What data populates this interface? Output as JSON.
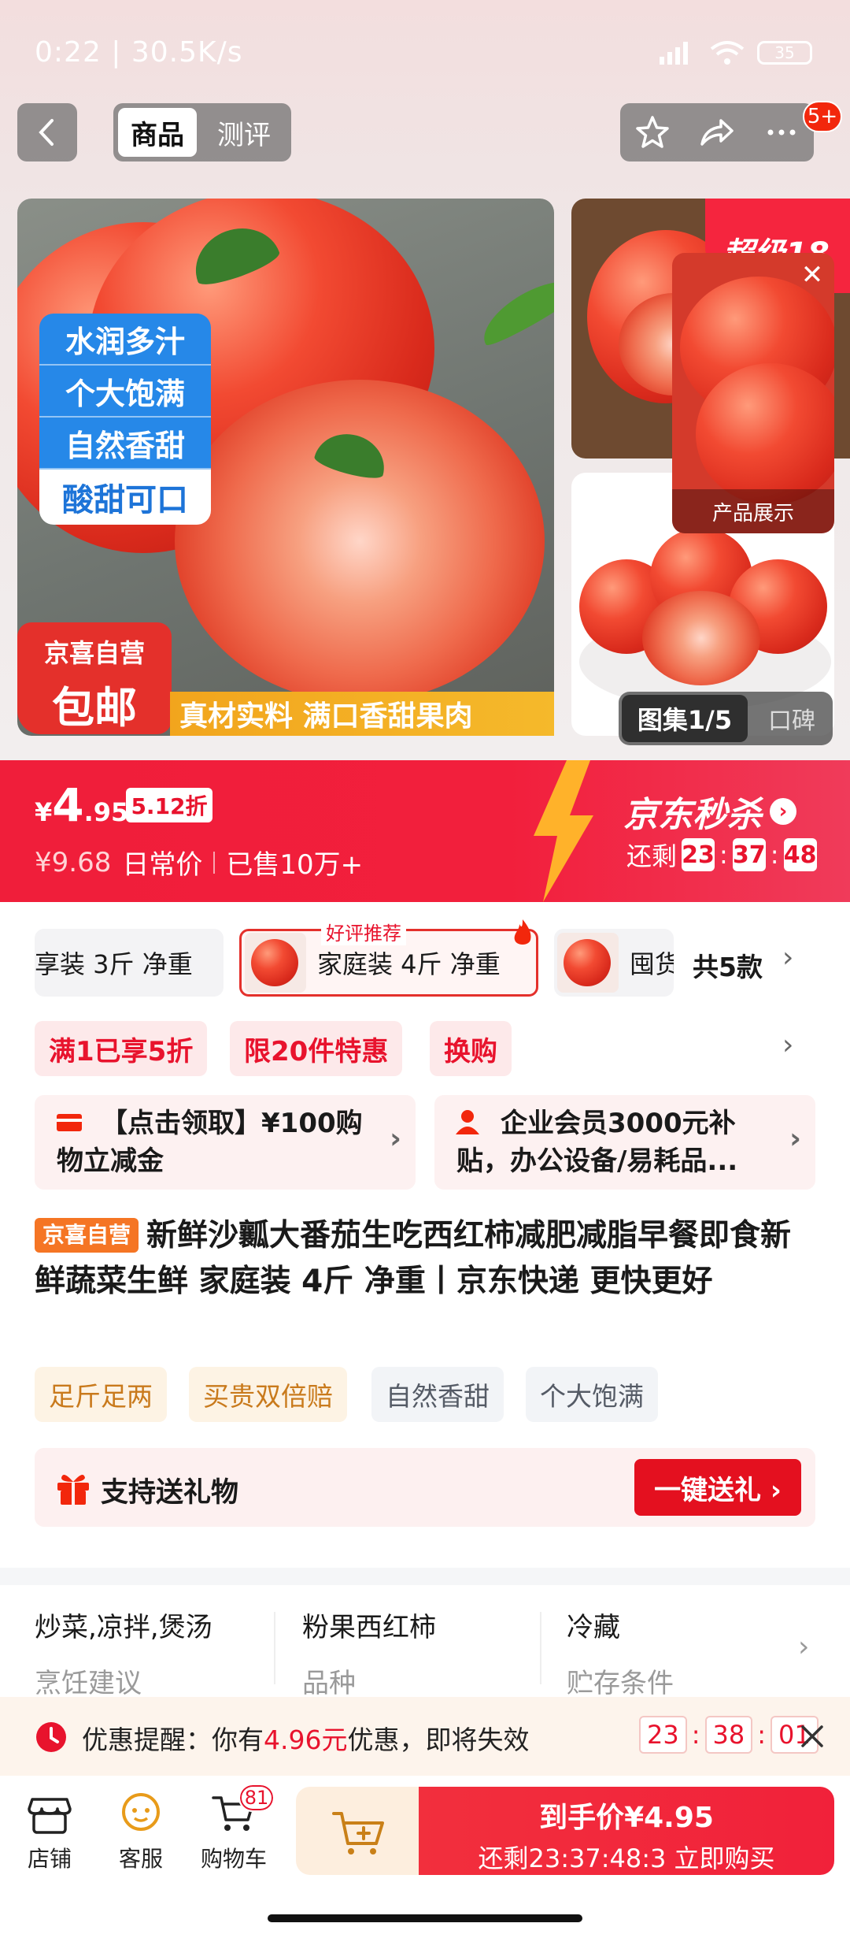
{
  "status_bar": {
    "time_speed": "0:22 | 30.5K/s",
    "battery": "35"
  },
  "nav": {
    "tabs": [
      "商品",
      "测评"
    ],
    "notification_count": "5+"
  },
  "image": {
    "tags": [
      "水润多汁",
      "个大饱满",
      "自然香甜",
      "酸甜可口"
    ],
    "badge_line1": "京喜自营",
    "badge_line2": "包邮",
    "banner": "真材实料 满口香甜果肉",
    "float_label": "产品展示",
    "gallery_label": "图集1/5",
    "review_label": "口碑",
    "corner_promo": "超级18"
  },
  "price": {
    "currency": "¥",
    "int": "4",
    "dec": ".95",
    "discount": "5.12折",
    "original": "¥9.68",
    "original_label": "日常价",
    "sold": "已售10万+",
    "seckill": "京东秒杀",
    "remaining_label": "还剩",
    "countdown": [
      "23",
      "37",
      "48"
    ]
  },
  "variants": {
    "items": [
      "享装 3斤 净重",
      "家庭装 4斤 净重",
      "囤货"
    ],
    "count": "共5款",
    "popular_tip": "好评推荐"
  },
  "promos": [
    "满1已享5折",
    "限20件特惠",
    "换购"
  ],
  "coupons": [
    {
      "text": "【点击领取】¥100购物立减金"
    },
    {
      "text": "企业会员3000元补贴，办公设备/易耗品..."
    }
  ],
  "product": {
    "store_tag": "京喜自营",
    "title": "新鲜沙瓤大番茄生吃西红柿减肥减脂早餐即食新鲜蔬菜生鲜 家庭装 4斤 净重丨京东快递 更快更好"
  },
  "features": [
    "足斤足两",
    "买贵双倍赔",
    "自然香甜",
    "个大饱满"
  ],
  "gift": {
    "label": "支持送礼物",
    "button": "一键送礼 ›"
  },
  "info": [
    {
      "value": "炒菜,凉拌,煲汤",
      "label": "烹饪建议"
    },
    {
      "value": "粉果西红柿",
      "label": "品种"
    },
    {
      "value": "冷藏",
      "label": "贮存条件"
    }
  ],
  "reminder": {
    "prefix": "优惠提醒：你有",
    "amount": "4.96元",
    "suffix": "优惠，即将失效",
    "countdown": [
      "23",
      "38",
      "01"
    ]
  },
  "bottom": {
    "store": "店铺",
    "service": "客服",
    "cart": "购物车",
    "cart_count": "81",
    "buy_line1": "到手价¥4.95",
    "buy_line2": "还剩23:37:48:3 立即购买"
  },
  "colors": {
    "brand_red": "#f21f3c",
    "accent_orange": "#f57524",
    "tag_blue": "#2688e8"
  }
}
